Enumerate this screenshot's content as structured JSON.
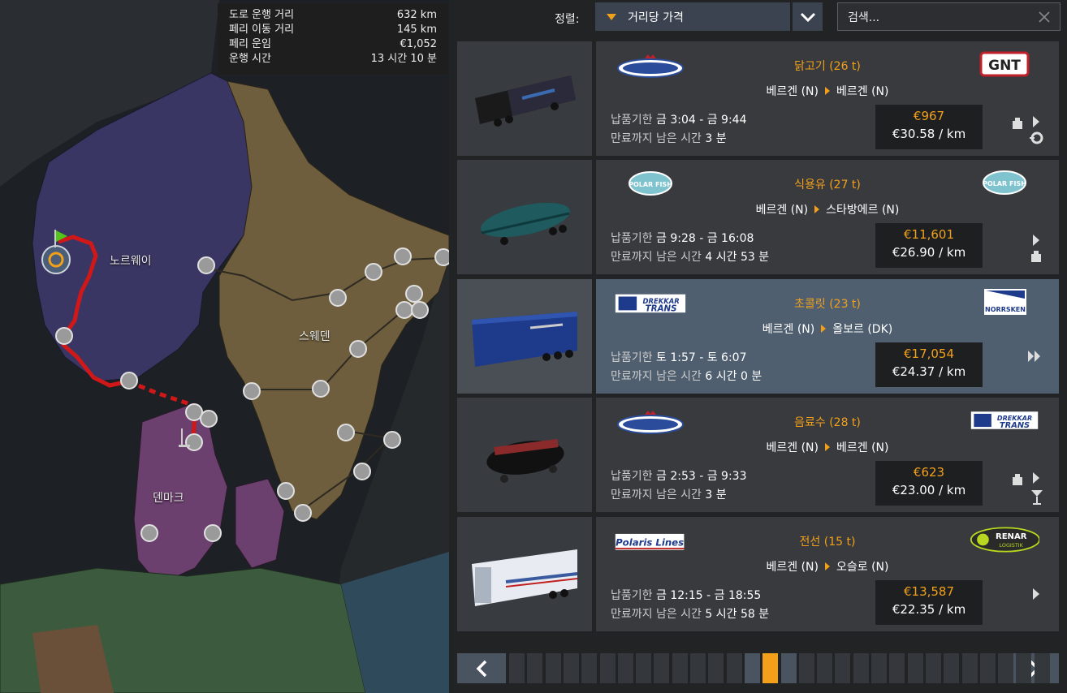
{
  "route_info": [
    {
      "label": "도로 운행 거리",
      "value": "632 km"
    },
    {
      "label": "페리 이동 거리",
      "value": "145 km"
    },
    {
      "label": "페리 운임",
      "value": "€1,052"
    },
    {
      "label": "운행 시간",
      "value": "13 시간 10 분"
    }
  ],
  "map_labels": {
    "norway": "노르웨이",
    "sweden": "스웨덴",
    "denmark": "덴마크"
  },
  "toolbar": {
    "sort_label": "정렬:",
    "sort_value": "거리당 가격",
    "search_placeholder": "검색..."
  },
  "jobs": [
    {
      "cargo": "닭고기 (26 t)",
      "from": "베르겐 (N)",
      "to": "베르겐 (N)",
      "deadline_label": "납품기한",
      "deadline": "금 3:04 - 금 9:44",
      "expire_label": "만료까지 남은 시간",
      "expire": "3 분",
      "price": "€967",
      "per_km": "€30.58 / km",
      "left_company": "NORDIC CROWN",
      "right_company": "GNT",
      "selected": false
    },
    {
      "cargo": "식용유 (27 t)",
      "from": "베르겐 (N)",
      "to": "스타방에르 (N)",
      "deadline_label": "납품기한",
      "deadline": "금 9:28 - 금 16:08",
      "expire_label": "만료까지 남은 시간",
      "expire": "4 시간 53 분",
      "price": "€11,601",
      "per_km": "€26.90 / km",
      "left_company": "POLAR FISH",
      "right_company": "POLAR FISH",
      "selected": false
    },
    {
      "cargo": "초콜릿 (23 t)",
      "from": "베르겐 (N)",
      "to": "올보르 (DK)",
      "deadline_label": "납품기한",
      "deadline": "토 1:57 - 토 6:07",
      "expire_label": "만료까지 남은 시간",
      "expire": "6 시간 0 분",
      "price": "€17,054",
      "per_km": "€24.37 / km",
      "left_company": "DREKKAR TRANS",
      "right_company": "NORRSKEN",
      "selected": true
    },
    {
      "cargo": "음료수 (28 t)",
      "from": "베르겐 (N)",
      "to": "베르겐 (N)",
      "deadline_label": "납품기한",
      "deadline": "금 2:53 - 금 9:33",
      "expire_label": "만료까지 남은 시간",
      "expire": "3 분",
      "price": "€623",
      "per_km": "€23.00 / km",
      "left_company": "NORDIC CROWN",
      "right_company": "DREKKAR TRANS",
      "selected": false
    },
    {
      "cargo": "전선 (15 t)",
      "from": "베르겐 (N)",
      "to": "오슬로 (N)",
      "deadline_label": "납품기한",
      "deadline": "금 12:15 - 금 18:55",
      "expire_label": "만료까지 남은 시간",
      "expire": "5 시간 58 분",
      "price": "€13,587",
      "per_km": "€22.35 / km",
      "left_company": "Polaris Lines",
      "right_company": "RENAR LOGISTIK",
      "selected": false
    }
  ],
  "pager": {
    "total_segments": 30,
    "current_segment": 14
  },
  "colors": {
    "accent": "#f2a01a",
    "norway": "#3a3663",
    "sweden": "#6e5e3d",
    "denmark": "#6b3f6e",
    "route": "#d01818"
  }
}
